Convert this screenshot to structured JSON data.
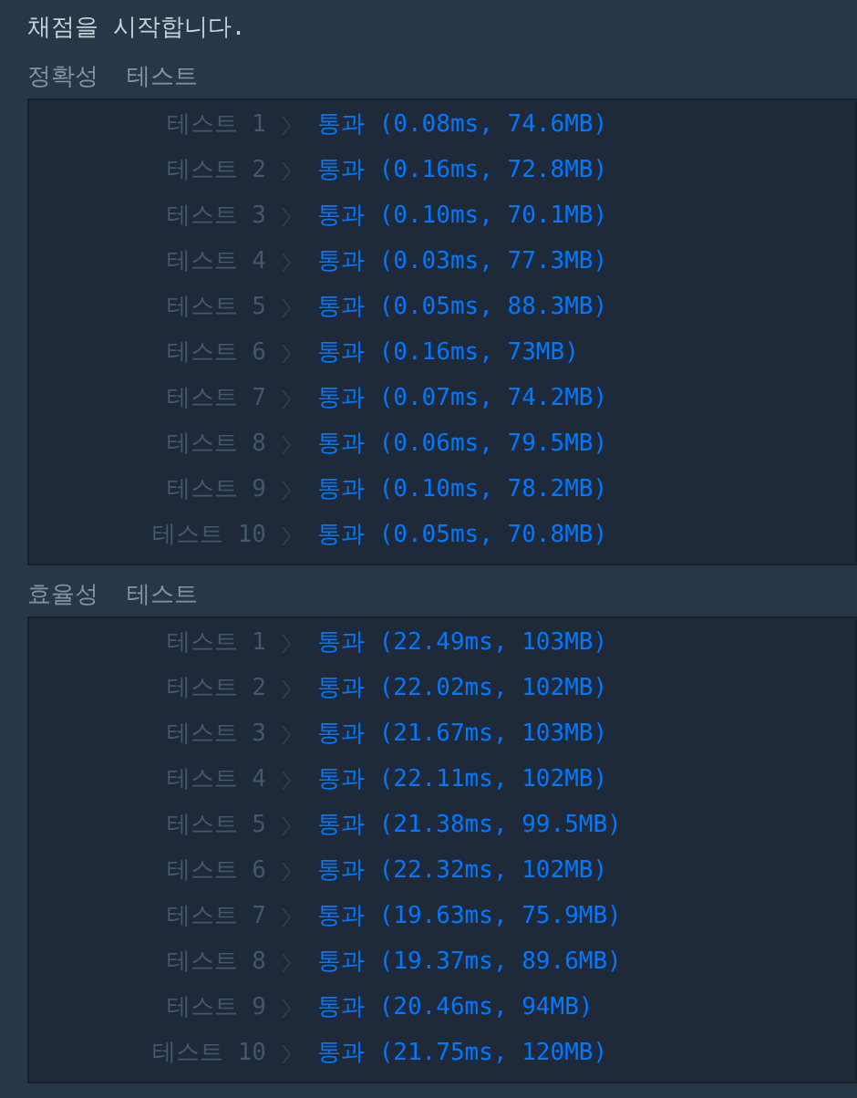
{
  "message": "채점을 시작합니다.",
  "sections": [
    {
      "title": "정확성  테스트",
      "rows": [
        {
          "label": "테스트 1",
          "status": "통과",
          "result": "(0.08ms, 74.6MB)"
        },
        {
          "label": "테스트 2",
          "status": "통과",
          "result": "(0.16ms, 72.8MB)"
        },
        {
          "label": "테스트 3",
          "status": "통과",
          "result": "(0.10ms, 70.1MB)"
        },
        {
          "label": "테스트 4",
          "status": "통과",
          "result": "(0.03ms, 77.3MB)"
        },
        {
          "label": "테스트 5",
          "status": "통과",
          "result": "(0.05ms, 88.3MB)"
        },
        {
          "label": "테스트 6",
          "status": "통과",
          "result": "(0.16ms, 73MB)"
        },
        {
          "label": "테스트 7",
          "status": "통과",
          "result": "(0.07ms, 74.2MB)"
        },
        {
          "label": "테스트 8",
          "status": "통과",
          "result": "(0.06ms, 79.5MB)"
        },
        {
          "label": "테스트 9",
          "status": "통과",
          "result": "(0.10ms, 78.2MB)"
        },
        {
          "label": "테스트 10",
          "status": "통과",
          "result": "(0.05ms, 70.8MB)"
        }
      ]
    },
    {
      "title": "효율성  테스트",
      "rows": [
        {
          "label": "테스트 1",
          "status": "통과",
          "result": "(22.49ms, 103MB)"
        },
        {
          "label": "테스트 2",
          "status": "통과",
          "result": "(22.02ms, 102MB)"
        },
        {
          "label": "테스트 3",
          "status": "통과",
          "result": "(21.67ms, 103MB)"
        },
        {
          "label": "테스트 4",
          "status": "통과",
          "result": "(22.11ms, 102MB)"
        },
        {
          "label": "테스트 5",
          "status": "통과",
          "result": "(21.38ms, 99.5MB)"
        },
        {
          "label": "테스트 6",
          "status": "통과",
          "result": "(22.32ms, 102MB)"
        },
        {
          "label": "테스트 7",
          "status": "통과",
          "result": "(19.63ms, 75.9MB)"
        },
        {
          "label": "테스트 8",
          "status": "통과",
          "result": "(19.37ms, 89.6MB)"
        },
        {
          "label": "테스트 9",
          "status": "통과",
          "result": "(20.46ms, 94MB)"
        },
        {
          "label": "테스트 10",
          "status": "통과",
          "result": "(21.75ms, 120MB)"
        }
      ]
    }
  ]
}
